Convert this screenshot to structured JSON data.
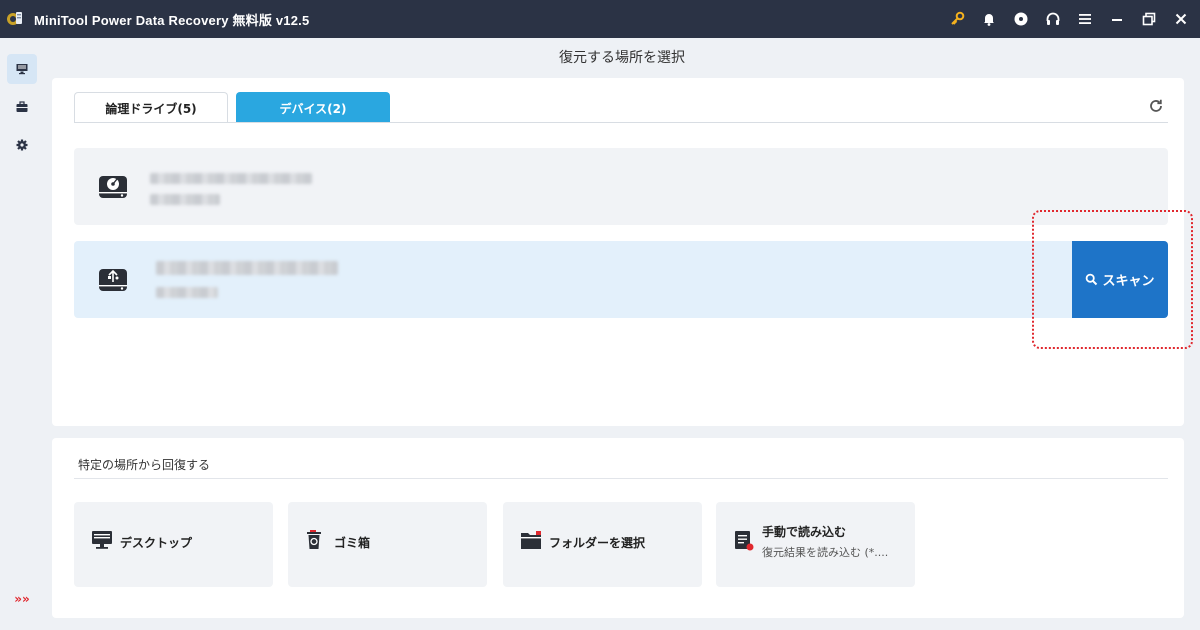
{
  "window": {
    "title": "MiniTool Power Data Recovery 無料版 v12.5"
  },
  "titlebar_icons": [
    "key-icon",
    "bell-icon",
    "disc-icon",
    "headset-icon",
    "menu-icon",
    "minimize-icon",
    "restore-icon",
    "close-icon"
  ],
  "header": {
    "title": "復元する場所を選択"
  },
  "tabs": [
    {
      "label": "論理ドライブ(5)",
      "active": false
    },
    {
      "label": "デバイス(2)",
      "active": true
    }
  ],
  "devices": [
    {
      "icon": "hard-drive-icon",
      "selected": false
    },
    {
      "icon": "usb-drive-icon",
      "selected": true
    }
  ],
  "scan": {
    "label": "スキャン",
    "icon": "search-icon"
  },
  "quick": {
    "title": "特定の場所から回復する",
    "items": [
      {
        "label": "デスクトップ",
        "icon": "desktop-icon"
      },
      {
        "label": "ゴミ箱",
        "icon": "recycle-bin-icon"
      },
      {
        "label": "フォルダーを選択",
        "icon": "folder-icon"
      },
      {
        "label": "手動で読み込む",
        "sub": "復元結果を読み込む (*....",
        "icon": "load-file-icon"
      }
    ]
  },
  "sidebar": {
    "items": [
      {
        "icon": "monitor-icon",
        "active": true
      },
      {
        "icon": "toolkit-icon",
        "active": false
      },
      {
        "icon": "settings-icon",
        "active": false
      }
    ],
    "expand_label": "»»"
  },
  "colors": {
    "titlebar": "#2b3345",
    "accent": "#2aa7e0",
    "scan_button": "#1e74c8",
    "highlight": "#e0282e",
    "key_icon": "#f5b21e"
  }
}
